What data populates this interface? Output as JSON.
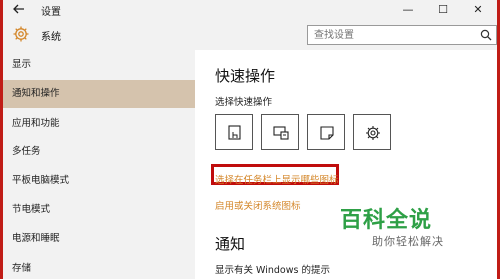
{
  "window": {
    "title": "设置",
    "back_icon": "arrow-left-icon",
    "controls": [
      "—",
      "☐",
      "✕"
    ]
  },
  "header": {
    "section": "系统",
    "search_placeholder": "查找设置"
  },
  "sidebar": {
    "items": [
      {
        "label": "显示"
      },
      {
        "label": "通知和操作",
        "selected": true
      },
      {
        "label": "应用和功能"
      },
      {
        "label": "多任务"
      },
      {
        "label": "平板电脑模式"
      },
      {
        "label": "节电模式"
      },
      {
        "label": "电源和睡眠"
      },
      {
        "label": "存储"
      }
    ]
  },
  "main": {
    "title": "快速操作",
    "subtitle": "选择快速操作",
    "tiles": [
      "tablet-mode-icon",
      "project-icon",
      "note-icon",
      "settings-gear-icon"
    ],
    "link_taskbar_icons": "选择在任务栏上显示哪些图标",
    "link_system_icons": "启用或关闭系统图标",
    "notifications_title": "通知",
    "notifications_sub": "显示有关 Windows 的提示"
  },
  "watermark": {
    "title": "百科全说",
    "subtitle": "助你轻松解决"
  },
  "colors": {
    "sidebar_bg": "#f2f2f2",
    "selected_bg": "#d5c3ad",
    "link": "#d4872a",
    "highlight_border": "#c00c0c",
    "watermark": "#2ea046"
  }
}
